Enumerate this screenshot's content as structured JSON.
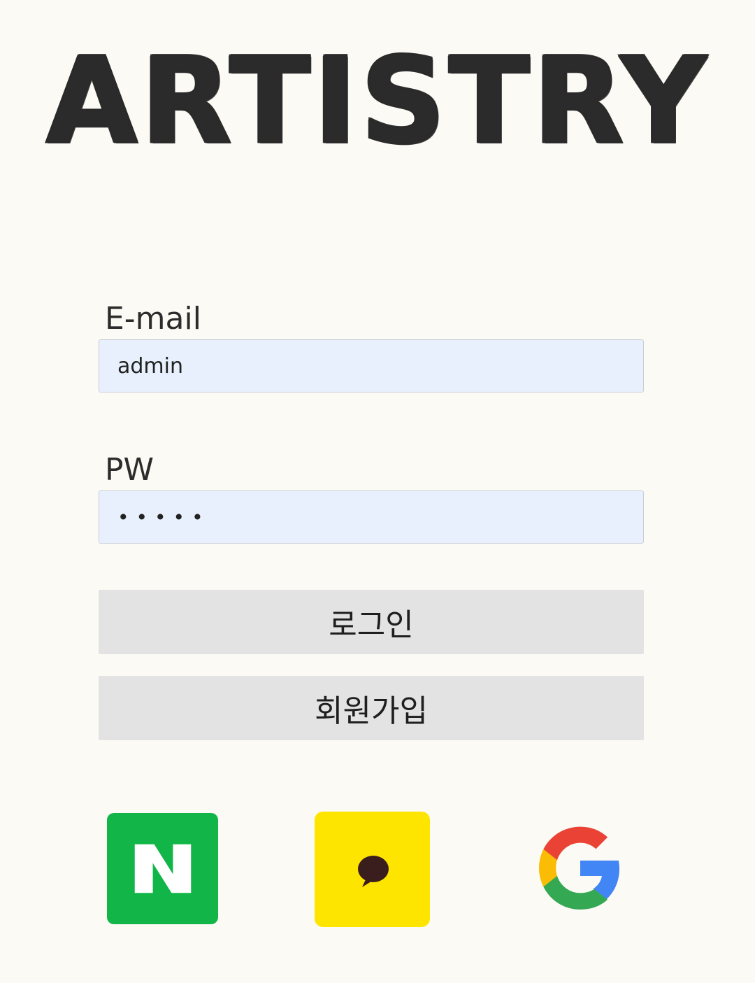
{
  "brand": {
    "logo_text": "ARTISTRY"
  },
  "login_form": {
    "email_label": "E-mail",
    "email_value": "admin",
    "pw_label": "PW",
    "pw_value": "admin"
  },
  "buttons": {
    "login_label": "로그인",
    "signup_label": "회원가입"
  },
  "social": [
    {
      "name": "naver",
      "icon": "naver-icon",
      "color": "#12b648"
    },
    {
      "name": "kakao",
      "icon": "kakao-icon",
      "color": "#fee500"
    },
    {
      "name": "google",
      "icon": "google-icon",
      "color": "#4285f4"
    }
  ],
  "colors": {
    "background": "#fcfaf5",
    "input_background": "#e8f0fd",
    "button_background": "#e3e3e3"
  }
}
